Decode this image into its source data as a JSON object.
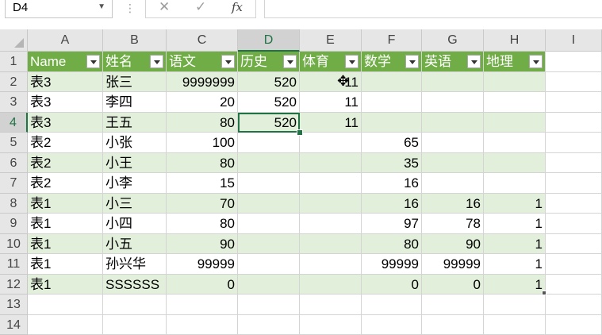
{
  "namebox": {
    "value": "D4"
  },
  "formula_bar": {
    "cancel_icon": "✕",
    "enter_icon": "✓",
    "fx_label": "fx",
    "content": ""
  },
  "columns": [
    "A",
    "B",
    "C",
    "D",
    "E",
    "F",
    "G",
    "H",
    "I"
  ],
  "selected_cell": "D4",
  "rows": [
    {
      "num": "1",
      "cells": [
        "Name",
        "姓名",
        "语文",
        "历史",
        "体育",
        "数学",
        "英语",
        "地理",
        ""
      ]
    },
    {
      "num": "2",
      "cells": [
        "表3",
        "张三",
        "9999999",
        "520",
        "11",
        "",
        "",
        "",
        ""
      ]
    },
    {
      "num": "3",
      "cells": [
        "表3",
        "李四",
        "20",
        "520",
        "11",
        "",
        "",
        "",
        ""
      ]
    },
    {
      "num": "4",
      "cells": [
        "表3",
        "王五",
        "80",
        "520",
        "11",
        "",
        "",
        "",
        ""
      ]
    },
    {
      "num": "5",
      "cells": [
        "表2",
        "小张",
        "100",
        "",
        "",
        "65",
        "",
        "",
        ""
      ]
    },
    {
      "num": "6",
      "cells": [
        "表2",
        "小王",
        "80",
        "",
        "",
        "35",
        "",
        "",
        ""
      ]
    },
    {
      "num": "7",
      "cells": [
        "表2",
        "小李",
        "15",
        "",
        "",
        "16",
        "",
        "",
        ""
      ]
    },
    {
      "num": "8",
      "cells": [
        "表1",
        "小三",
        "70",
        "",
        "",
        "16",
        "16",
        "1",
        ""
      ]
    },
    {
      "num": "9",
      "cells": [
        "表1",
        "小四",
        "80",
        "",
        "",
        "97",
        "78",
        "1",
        ""
      ]
    },
    {
      "num": "10",
      "cells": [
        "表1",
        "小五",
        "90",
        "",
        "",
        "80",
        "90",
        "1",
        ""
      ]
    },
    {
      "num": "11",
      "cells": [
        "表1",
        "孙兴华",
        "99999",
        "",
        "",
        "99999",
        "99999",
        "1",
        ""
      ]
    },
    {
      "num": "12",
      "cells": [
        "表1",
        "SSSSSS",
        "0",
        "",
        "",
        "0",
        "0",
        "1",
        ""
      ]
    },
    {
      "num": "13",
      "cells": [
        "",
        "",
        "",
        "",
        "",
        "",
        "",
        "",
        ""
      ]
    },
    {
      "num": "14",
      "cells": [
        "",
        "",
        "",
        "",
        "",
        "",
        "",
        "",
        ""
      ]
    }
  ],
  "colors": {
    "header_fill": "#70ad47",
    "band_fill": "#e2efda",
    "accent": "#217346"
  }
}
